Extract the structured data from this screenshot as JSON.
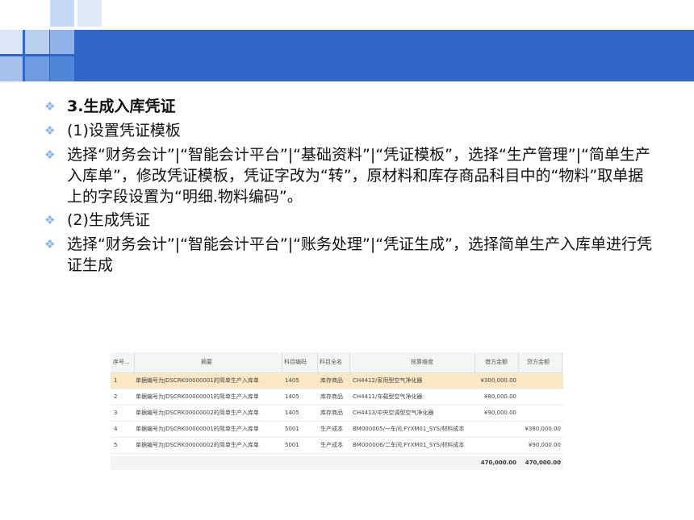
{
  "bullets": [
    {
      "text": "3.生成入库凭证",
      "bold": true
    },
    {
      "text": "(1)设置凭证模板",
      "bold": false
    },
    {
      "text": "选择“财务会计”|“智能会计平台”|“基础资料”|“凭证模板”，选择“生产管理”|“简单生产入库单”，修改凭证模板，凭证字改为“转”，原材料和库存商品科目中的“物料”取单据上的字段设置为“明细.物料编码”。",
      "bold": false
    },
    {
      "text": " (2)生成凭证",
      "bold": false
    },
    {
      "text": "选择“财务会计”|“智能会计平台”|“账务处理”|“凭证生成”，选择简单生产入库单进行凭证生成",
      "bold": false
    }
  ],
  "table": {
    "headers": {
      "seq": "序号...",
      "summary": "摘要",
      "account_code": "科目编码",
      "account_name": "科目全名",
      "dimension": "核算维度",
      "debit": "借方金额",
      "credit": "贷方金额"
    },
    "rows": [
      {
        "seq": "1",
        "summary": "单据编号为JDSCRK00000001的简单生产入库单",
        "account_code": "1405",
        "account_name": "库存商品",
        "dimension": "CH4412/家用型空气净化器",
        "debit": "¥300,000.00",
        "credit": ""
      },
      {
        "seq": "2",
        "summary": "单据编号为JDSCRK00000001的简单生产入库单",
        "account_code": "1405",
        "account_name": "库存商品",
        "dimension": "CH4411/车载型空气净化器",
        "debit": "¥80,000.00",
        "credit": ""
      },
      {
        "seq": "3",
        "summary": "单据编号为JDSCRK00000002的简单生产入库单",
        "account_code": "1405",
        "account_name": "库存商品",
        "dimension": "CH4413/中央空调型空气净化器",
        "debit": "¥90,000.00",
        "credit": ""
      },
      {
        "seq": "4",
        "summary": "单据编号为JDSCRK00000001的简单生产入库单",
        "account_code": "5001",
        "account_name": "生产成本",
        "dimension": "BM000005/一车间;FYXM01_SYS/材料成本",
        "debit": "",
        "credit": "¥380,000.00"
      },
      {
        "seq": "5",
        "summary": "单据编号为JDSCRK00000002的简单生产入库单",
        "account_code": "5001",
        "account_name": "生产成本",
        "dimension": "BM000006/二车间;FYXM01_SYS/材料成本",
        "debit": "",
        "credit": "¥90,000.00"
      }
    ],
    "totals": {
      "debit": "470,000.00",
      "credit": "470,000.00"
    },
    "selected_row": 0,
    "selected_color": "#fde8c6"
  },
  "colors": {
    "header_band": "#3166c8",
    "bullet": "#8ab4e6"
  }
}
